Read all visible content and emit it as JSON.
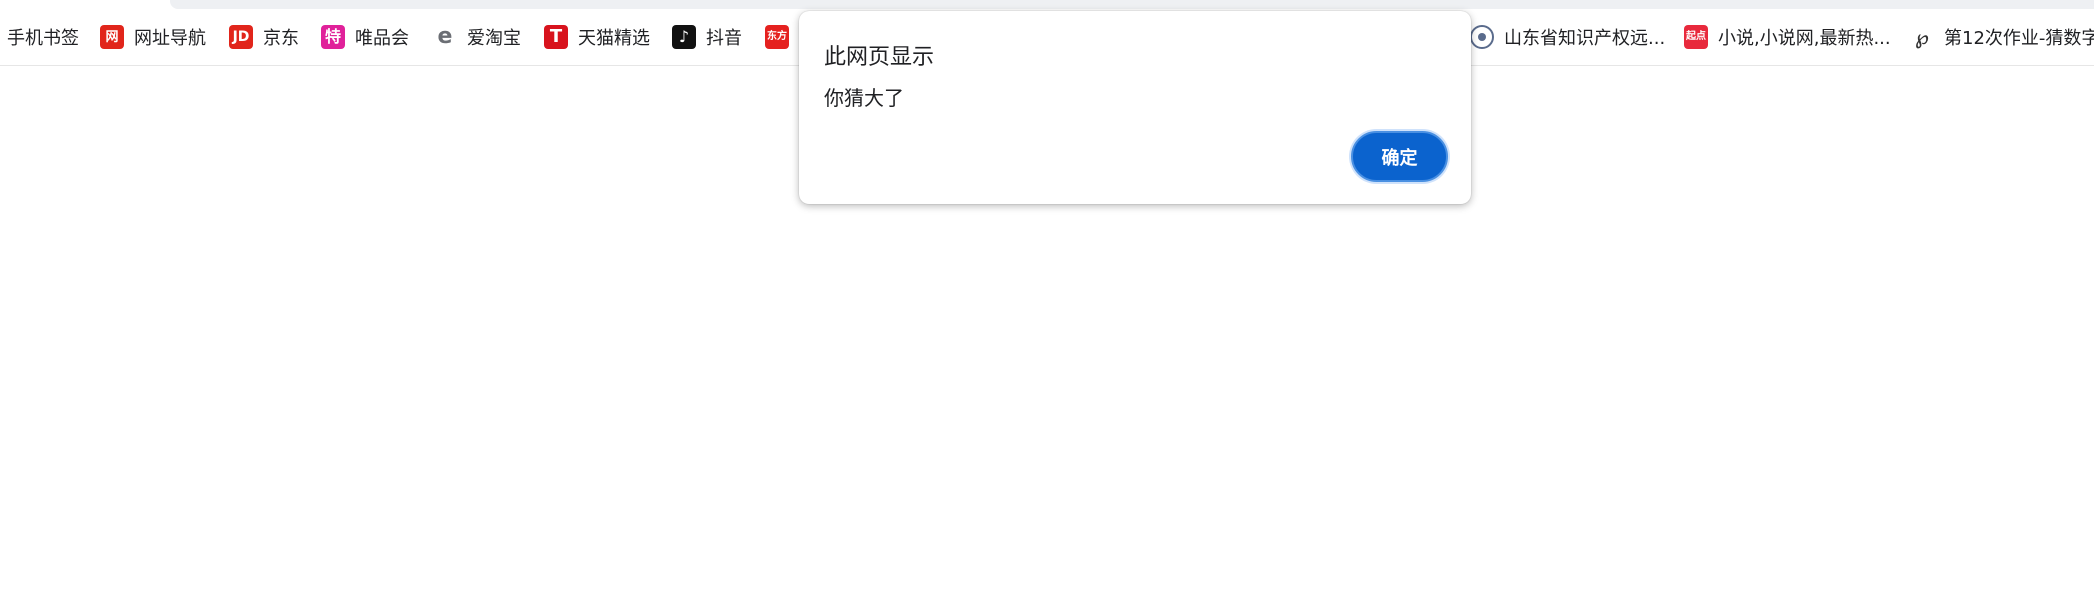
{
  "bookmarks": [
    {
      "label": "手机书签",
      "icon": "none"
    },
    {
      "label": "网址导航",
      "icon": "hao123-icon",
      "glyph": "网"
    },
    {
      "label": "京东",
      "icon": "jd-icon",
      "glyph": "JD"
    },
    {
      "label": "唯品会",
      "icon": "vipshop-icon",
      "glyph": "特"
    },
    {
      "label": "爱淘宝",
      "icon": "aitaobao-icon",
      "glyph": "e"
    },
    {
      "label": "天猫精选",
      "icon": "tmall-icon",
      "glyph": "T"
    },
    {
      "label": "抖音",
      "icon": "douyin-icon",
      "glyph": "♪"
    },
    {
      "label": "",
      "icon": "dongfang-icon",
      "glyph": "东方"
    },
    {
      "label": "山东省知识产权远...",
      "icon": "seal-icon",
      "glyph": ""
    },
    {
      "label": "小说,小说网,最新热...",
      "icon": "qidian-icon",
      "glyph": "起点"
    },
    {
      "label": "第12次作业-猜数字",
      "icon": "signature-icon",
      "glyph": "℘"
    }
  ],
  "dialog": {
    "title": "此网页显示",
    "message": "你猜大了",
    "ok_label": "确定"
  },
  "colors": {
    "primary_button": "#0b63ce",
    "button_border": "#4a90e2"
  }
}
